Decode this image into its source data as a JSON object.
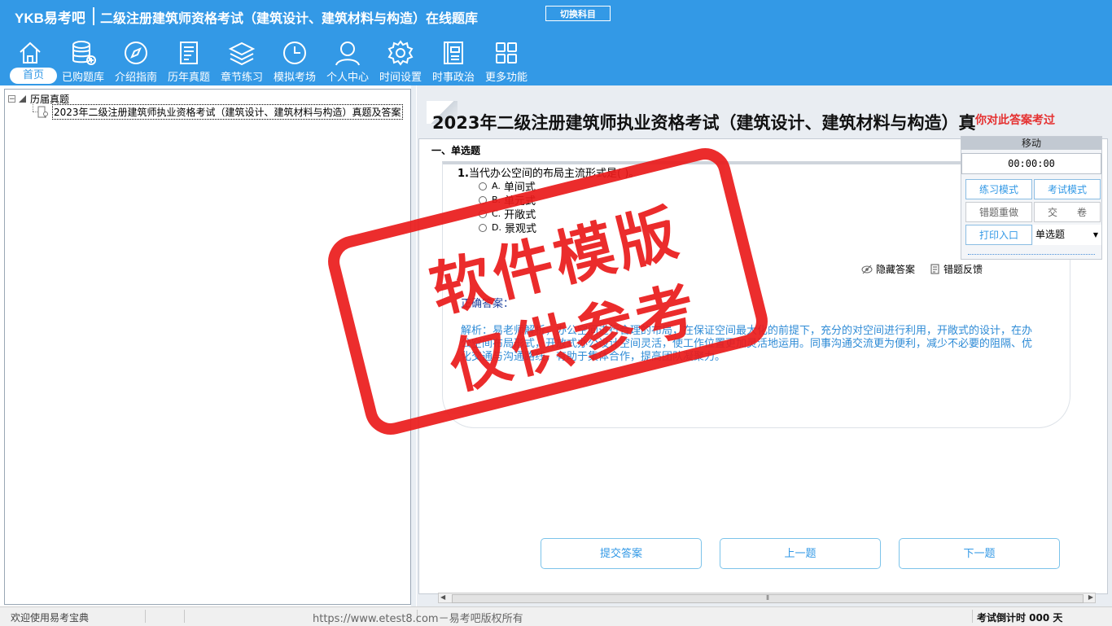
{
  "header": {
    "logo": "YKB易考吧",
    "title": "二级注册建筑师资格考试（建筑设计、建筑材料与构造）在线题库",
    "switch_subject": "切换科目"
  },
  "nav": [
    {
      "label": "首页",
      "icon": "home-icon",
      "active": true
    },
    {
      "label": "已购题库",
      "icon": "database-icon"
    },
    {
      "label": "介绍指南",
      "icon": "compass-icon"
    },
    {
      "label": "历年真题",
      "icon": "document-list-icon"
    },
    {
      "label": "章节练习",
      "icon": "layers-icon"
    },
    {
      "label": "模拟考场",
      "icon": "clock-icon"
    },
    {
      "label": "个人中心",
      "icon": "user-icon"
    },
    {
      "label": "时间设置",
      "icon": "gear-icon"
    },
    {
      "label": "时事政治",
      "icon": "newspaper-icon"
    },
    {
      "label": "更多功能",
      "icon": "grid-icon"
    }
  ],
  "tree": {
    "root": "历届真题",
    "child": "2023年二级注册建筑师执业资格考试（建筑设计、建筑材料与构造）真题及答案"
  },
  "paper": {
    "title": "2023年二级注册建筑师执业资格考试（建筑设计、建筑材料与构造）真",
    "red_note": "你对此答案考过"
  },
  "section_title": "一、单选题",
  "question": {
    "number": "1.",
    "stem": "当代办公空间的布局主流形式是(  )。",
    "options": [
      {
        "letter": "A.",
        "text": "单间式"
      },
      {
        "letter": "B.",
        "text": "单元式"
      },
      {
        "letter": "C.",
        "text": "开敞式"
      },
      {
        "letter": "D.",
        "text": "景观式"
      }
    ],
    "hide_answer": "隐藏答案",
    "feedback": "错题反馈",
    "correct_answer_label": "正确答案：",
    "analysis": "解析：易老师解析，办公空间进行合理的布局，在保证空间最大化的前提下，充分的对空间进行利用，开敞式的设计，在办公空间布局形式，开放式办公设计空间灵活，使工作位置更加灵活地运用。同事沟通交流更为便利，减少不必要的阻隔、优化交通与沟通路线，有助于集体合作，提高团队凝聚力。"
  },
  "buttons": {
    "submit": "提交答案",
    "prev": "上一题",
    "next": "下一题"
  },
  "widget": {
    "move": "移动",
    "timer": "00:00:00",
    "practice_mode": "练习模式",
    "exam_mode": "考试模式",
    "redo_wrong": "错题重做",
    "hand_in": "交　　卷",
    "print": "打印入口",
    "question_type": "单选题"
  },
  "statusbar": {
    "welcome": "欢迎使用易考宝典",
    "url": "https://www.etest8.com－易考吧版权所有",
    "countdown": "考试倒计时 000 天"
  },
  "watermark": {
    "line1": "软件模版",
    "line2": "仅供参考"
  },
  "colors": {
    "header_bg": "#3399e6",
    "accent": "#3399e6",
    "stamp_red": "#ea1b1b",
    "analysis_blue": "#2e8bd6"
  }
}
